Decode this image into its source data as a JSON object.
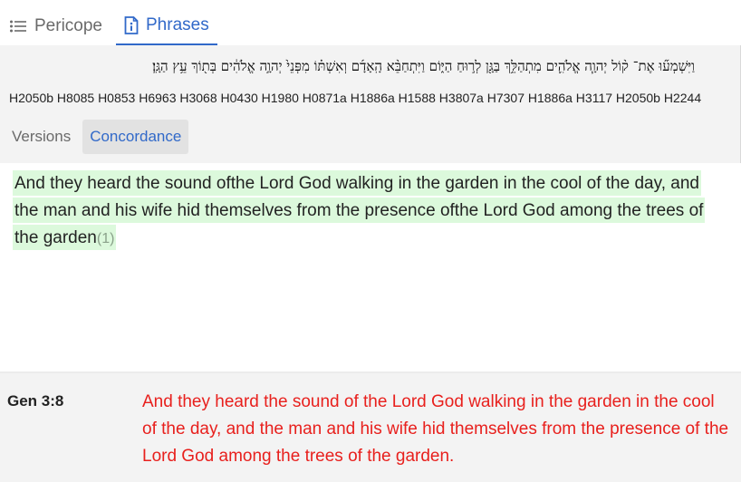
{
  "tabs": {
    "pericope_label": "Pericope",
    "phrases_label": "Phrases"
  },
  "hebrew": {
    "text": "וַיִּשְׁמְע֞וּ אֶת־ ק֨וֹל יְהוָ֧ה אֱלֹהִ֛ים מִתְהַלֵּ֥ךְ בַּגָּ֖ן לְר֣וּחַ הַיּ֑וֹם וַיִּתְחַבֵּ֨א הָֽאָדָ֜ם וְאִשְׁתּ֗וֹ מִפְּנֵי֙ יְהוָ֣ה אֱלֹהִ֔ים בְּת֖וֹךְ עֵ֥ץ הַגָּֽן׃",
    "strongs": "H2050b H8085 H0853 H6963 H3068 H0430 H1980 H0871a H1886a H1588 H3807a H7307 H1886a H3117 H2050b H2244"
  },
  "subtabs": {
    "versions_label": "Versions",
    "concordance_label": "Concordance"
  },
  "results": {
    "text": "And they heard the sound ofthe Lord God walking in the garden in the cool of the day, and the man and his wife hid themselves from the presence ofthe Lord God among the trees of the garden",
    "count": "(1)"
  },
  "verse": {
    "reference": "Gen 3:8",
    "text": "And they heard the sound of the Lord God walking in the garden in the cool of the day, and the man and his wife hid themselves from the presence of the Lord God among the trees of the garden."
  },
  "colors": {
    "accent": "#3169c9",
    "highlight": "#dcf9dc",
    "verse_red": "#e8201d"
  }
}
